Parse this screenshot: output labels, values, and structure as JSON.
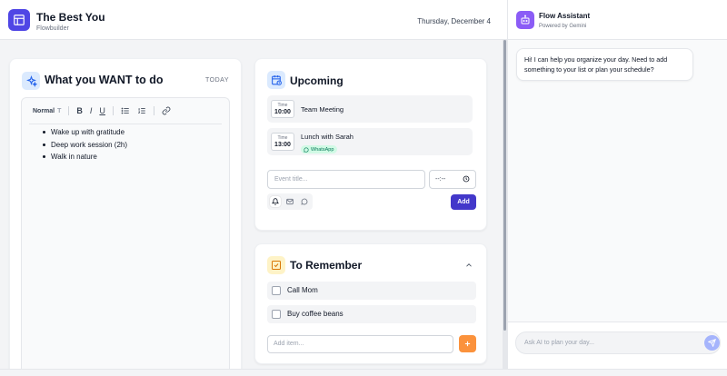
{
  "app": {
    "title": "The Best You",
    "subtitle": "Flowbuilder"
  },
  "header": {
    "date": "Thursday, December 4"
  },
  "want": {
    "title": "What you WANT to do",
    "today_label": "TODAY",
    "toolbar": {
      "style": "Normal",
      "bold": "B",
      "italic": "I",
      "underline": "U"
    },
    "items": [
      "Wake up with gratitude",
      "Deep work session (2h)",
      "Walk in nature"
    ]
  },
  "upcoming": {
    "title": "Upcoming",
    "events": [
      {
        "time_label": "Time",
        "time": "10:00",
        "title": "Team Meeting"
      },
      {
        "time_label": "Time",
        "time": "13:00",
        "title": "Lunch with Sarah",
        "badge": "WhatsApp"
      }
    ],
    "event_placeholder": "Event title...",
    "time_value": "--:--",
    "add_label": "Add"
  },
  "remember": {
    "title": "To Remember",
    "items": [
      "Call Mom",
      "Buy coffee beans"
    ],
    "add_placeholder": "Add item..."
  },
  "chat": {
    "title": "Flow Assistant",
    "subtitle": "Powered by Gemini",
    "message": "Hi! I can help you organize your day. Need to add something to your list or plan your schedule?",
    "input_placeholder": "Ask AI to plan your day..."
  },
  "colors": {
    "primary": "#4f46e5",
    "chat_accent": "#8b5cf6",
    "add_orange": "#fb923c",
    "whatsapp_green": "#047857"
  },
  "icons": [
    "layout-icon",
    "sparkles-icon",
    "calendar-clock-icon",
    "check-square-icon",
    "bot-icon",
    "bell-icon",
    "mail-icon",
    "chat-icon",
    "clock-icon",
    "send-icon",
    "plus-icon",
    "chevron-up-icon",
    "link-icon"
  ]
}
